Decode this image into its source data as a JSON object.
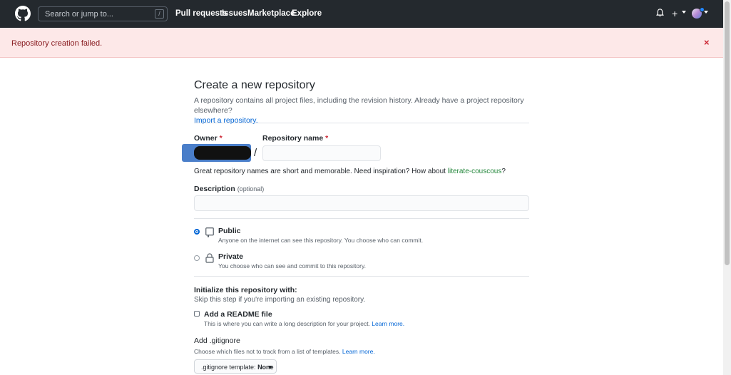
{
  "header": {
    "search_placeholder": "Search or jump to...",
    "search_shortcut": "/",
    "nav": [
      "Pull requests",
      "Issues",
      "Marketplace",
      "Explore"
    ],
    "plus_label": "+"
  },
  "flash": {
    "message": "Repository creation failed.",
    "close": "×"
  },
  "form": {
    "title": "Create a new repository",
    "lead": "A repository contains all project files, including the revision history. Already have a project repository elsewhere?",
    "import_link": "Import a repository.",
    "owner_label": "Owner",
    "repo_name_label": "Repository name",
    "required_mark": "*",
    "separator": "/",
    "name_hint": "Great repository names are short and memorable. Need inspiration? How about",
    "name_suggestion": "literate-couscous",
    "name_hint_end": "?",
    "description_label": "Description",
    "description_optional": "(optional)",
    "visibility": [
      {
        "title": "Public",
        "desc": "Anyone on the internet can see this repository. You choose who can commit.",
        "selected": true
      },
      {
        "title": "Private",
        "desc": "You choose who can see and commit to this repository.",
        "selected": false
      }
    ],
    "init_title": "Initialize this repository with:",
    "init_desc": "Skip this step if you're importing an existing repository.",
    "readme_label": "Add a README file",
    "readme_desc": "This is where you can write a long description for your project.",
    "learn_more": "Learn more.",
    "gitignore_label": "Add .gitignore",
    "gitignore_desc": "Choose which files not to track from a list of templates.",
    "gitignore_btn_prefix": ".gitignore template:",
    "gitignore_btn_value": "None"
  },
  "colors": {
    "header_bg": "#24292e",
    "flash_bg": "#fde8e8",
    "link": "#0366d6",
    "suggestion": "#22863a",
    "required": "#cb2431"
  }
}
